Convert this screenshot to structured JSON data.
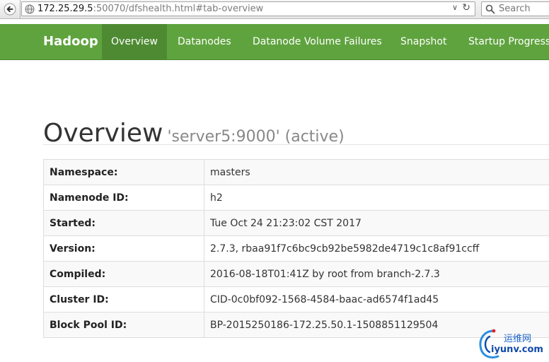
{
  "browser": {
    "url_host": "172.25.29.5",
    "url_rest": ":50070/dfshealth.html#tab-overview",
    "search_placeholder": "Search",
    "dropdown_glyph": "∨",
    "reload_glyph": "↻"
  },
  "navbar": {
    "brand": "Hadoop",
    "items": [
      {
        "label": "Overview",
        "active": true
      },
      {
        "label": "Datanodes",
        "active": false
      },
      {
        "label": "Datanode Volume Failures",
        "active": false
      },
      {
        "label": "Snapshot",
        "active": false
      },
      {
        "label": "Startup Progress",
        "active": false
      }
    ]
  },
  "overview": {
    "title": "Overview",
    "subtitle": "'server5:9000' (active)",
    "rows": [
      {
        "key": "Namespace:",
        "value": "masters"
      },
      {
        "key": "Namenode ID:",
        "value": "h2"
      },
      {
        "key": "Started:",
        "value": "Tue Oct 24 21:23:02 CST 2017"
      },
      {
        "key": "Version:",
        "value": "2.7.3, rbaa91f7c6bc9cb92be5982de4719c1c8af91ccff"
      },
      {
        "key": "Compiled:",
        "value": "2016-08-18T01:41Z by root from branch-2.7.3"
      },
      {
        "key": "Cluster ID:",
        "value": "CID-0c0bf092-1568-4584-baac-ad6574f1ad45"
      },
      {
        "key": "Block Pool ID:",
        "value": "BP-2015250186-172.25.50.1-1508851129504"
      }
    ]
  },
  "watermark": {
    "cn": "运维网",
    "en": "iyunv.com"
  },
  "colors": {
    "navbar": "#5fa33e",
    "navbar_active": "#4e8a32"
  }
}
